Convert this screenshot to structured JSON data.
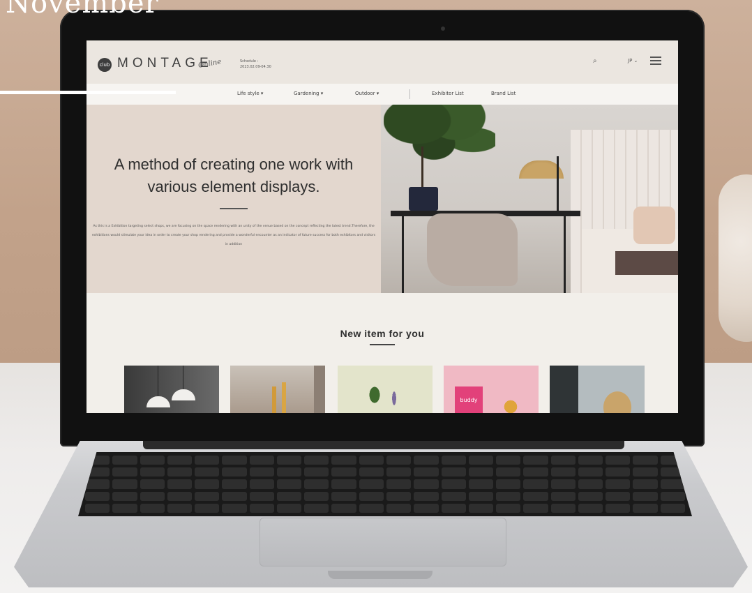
{
  "overlay": {
    "title": "November"
  },
  "site": {
    "logo_badge": "club",
    "logo_text": "MONTAGE",
    "logo_script": "Online",
    "schedule_label": "Schedule :",
    "schedule_dates": "2023.02.09-04.30",
    "lang": "JP ⌄",
    "search_glyph": "⌕"
  },
  "nav": {
    "items": [
      "Life style ▾",
      "Gardening ▾",
      "Outdoor ▾",
      "Exhibitor List",
      "Brand List"
    ]
  },
  "hero": {
    "title_line1": "A method of creating one work with",
    "title_line2": "various element displays.",
    "body": "As this is a Exhibition targeting select shops, we are focusing on the space rendering with an unity of the venue based on the concept reflecting the latest trend.Therefore, the exhibitions would stimulate your idea in order to create your shop rendering and provide a wonderful encounter as an indicator of future success for both exhibitors and visitors in addition"
  },
  "new_items": {
    "title": "New item for you",
    "cards": [
      {
        "name": "pendant-lamps",
        "bg": "#4a4a4a"
      },
      {
        "name": "candles",
        "bg": "#bcb2a8"
      },
      {
        "name": "botanical",
        "bg": "#e1e2c8"
      },
      {
        "name": "pink-package",
        "bg": "#efb7c2",
        "label": "buddy"
      },
      {
        "name": "dried-flowers",
        "bg": "#a9b1b4"
      }
    ]
  },
  "colors": {
    "accent_dark": "#2f2f2f",
    "hero_bg": "#e3d7ce",
    "header_bg": "#ebe6e0"
  }
}
